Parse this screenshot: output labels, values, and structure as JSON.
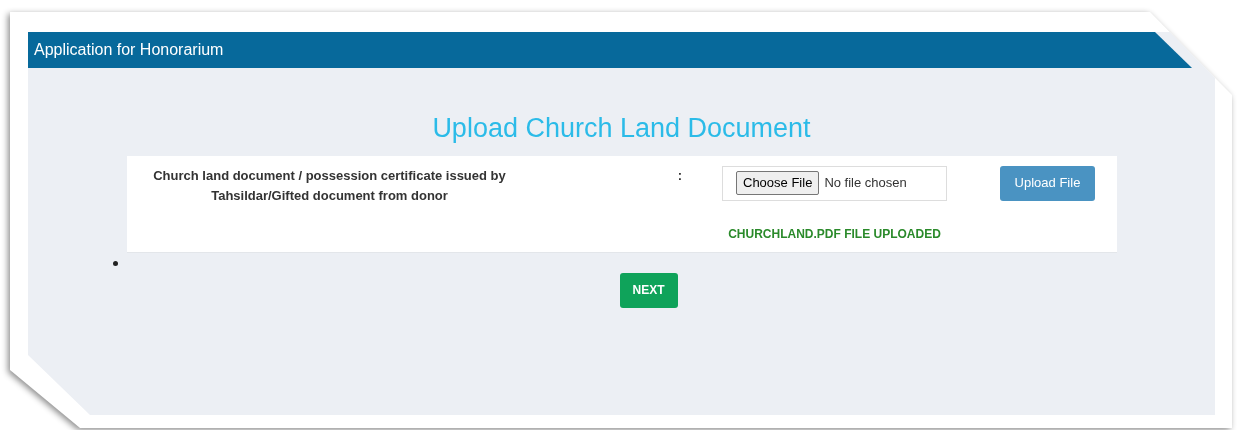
{
  "header": {
    "title": "Application for Honorarium"
  },
  "heading": "Upload Church Land Document",
  "upload_row": {
    "label": "Church land document / possession certificate issued by Tahsildar/Gifted document from donor",
    "separator": ":",
    "choose_button": "Choose File",
    "file_status": "No file chosen",
    "upload_button": "Upload File",
    "message": "CHURCHLAND.PDF FILE UPLOADED"
  },
  "next_button": "NEXT"
}
